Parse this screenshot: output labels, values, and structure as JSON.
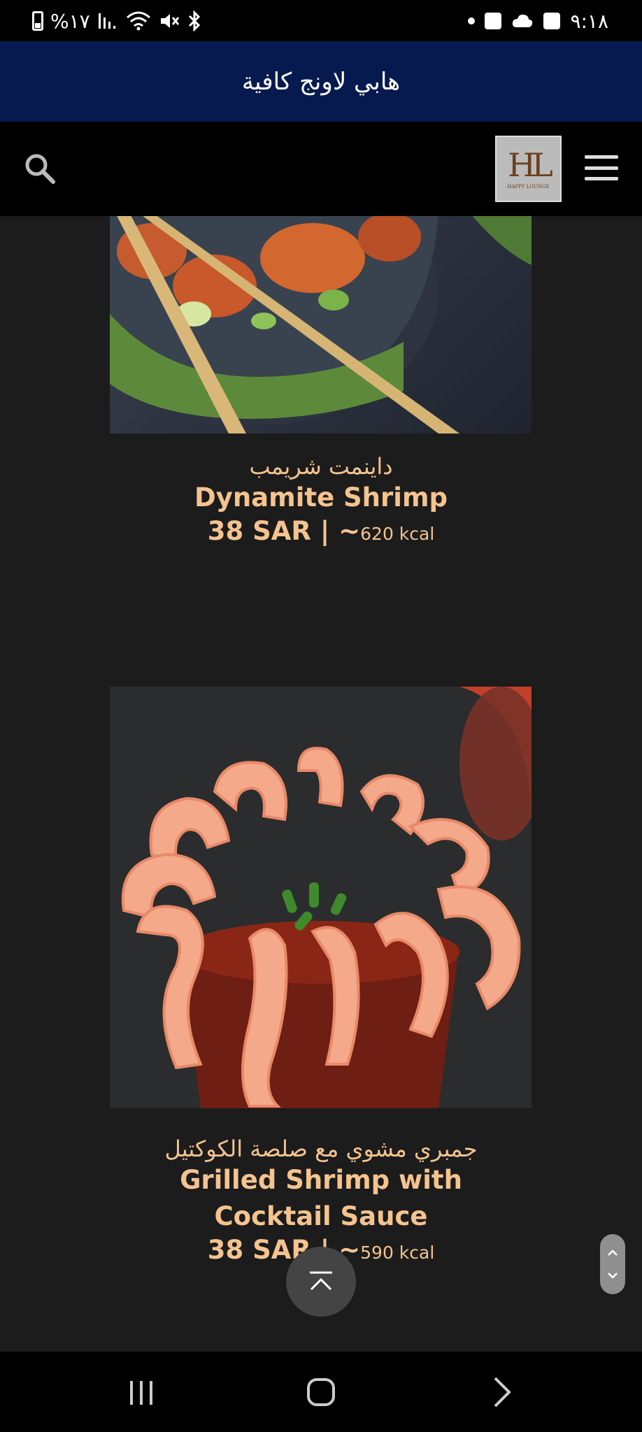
{
  "status": {
    "battery_text": "%١٧",
    "time": "٩:١٨"
  },
  "header": {
    "title": "هابي لاونج كافية",
    "logo_monogram": "HL",
    "logo_caption": "HAPPY LOUNGE"
  },
  "menu_items": [
    {
      "name_ar": "داينمت شريمب",
      "name_en": "Dynamite Shrimp",
      "price": "38 SAR",
      "separator": " | ~",
      "kcal": "620 kcal"
    },
    {
      "name_ar": "جمبري مشوي مع صلصة الكوكتيل",
      "name_en": "Grilled Shrimp with Cocktail Sauce",
      "price": "38 SAR",
      "separator": " | ~",
      "kcal": "590 kcal"
    }
  ],
  "colors": {
    "banner": "#071a4f",
    "accent_text": "#f4c38f",
    "background": "#1c1c1c"
  },
  "icons": [
    "search-icon",
    "menu-icon",
    "scroll-to-top-icon",
    "recents-icon",
    "home-icon",
    "back-icon"
  ]
}
